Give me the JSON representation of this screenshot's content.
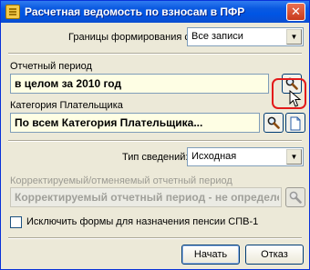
{
  "window": {
    "title": "Расчетная ведомость по взносам в ПФР",
    "close_glyph": "✕"
  },
  "bounds": {
    "label": "Границы формирования списка:",
    "value": "Все записи"
  },
  "period": {
    "label": "Отчетный период",
    "value": "в целом за 2010 год"
  },
  "payer": {
    "label": "Категория Плательщика",
    "value": "По всем Категория Плательщика..."
  },
  "info_type": {
    "label": "Тип сведений:",
    "value": "Исходная"
  },
  "corrected": {
    "label": "Корректируемый/отменяемый отчетный период",
    "value": "Корректируемый отчетный период - не определен..."
  },
  "exclude": {
    "label": "Исключить формы для назначения пенсии СПВ-1",
    "checked": false
  },
  "buttons": {
    "start": "Начать",
    "cancel": "Отказ"
  },
  "colors": {
    "accent": "#0a59e0",
    "highlight": "#e31a1a",
    "field_bg": "#fefee4"
  }
}
